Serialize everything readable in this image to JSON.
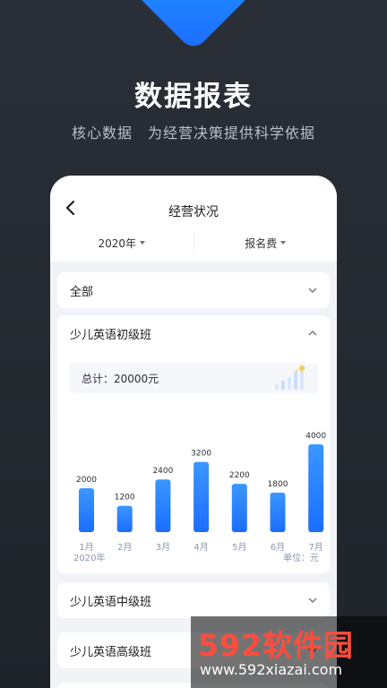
{
  "hero": {
    "title": "数据报表",
    "subtitle": "核心数据　为经营决策提供科学依据"
  },
  "screen": {
    "title": "经营状况",
    "filters": [
      {
        "label": "2020年"
      },
      {
        "label": "报名费"
      }
    ]
  },
  "sections": {
    "all": "全部",
    "beginner": "少儿英语初级班",
    "intermediate": "少儿英语中级班",
    "advanced": "少儿英语高级班"
  },
  "summary": {
    "total_text": "总计：20000元"
  },
  "chart_data": {
    "type": "bar",
    "categories": [
      "1月",
      "2月",
      "3月",
      "4月",
      "5月",
      "6月",
      "7月"
    ],
    "values": [
      2000,
      1200,
      2400,
      3200,
      2200,
      1800,
      4000
    ],
    "title": "",
    "xlabel": "2020年",
    "ylabel": "",
    "unit_label": "单位：元",
    "ylim": [
      0,
      4000
    ],
    "grid": false,
    "colors": [
      "#2d8cff",
      "#1c6dff"
    ]
  },
  "watermark": {
    "main": "592软件园",
    "url": "www.592xiazai.com"
  }
}
